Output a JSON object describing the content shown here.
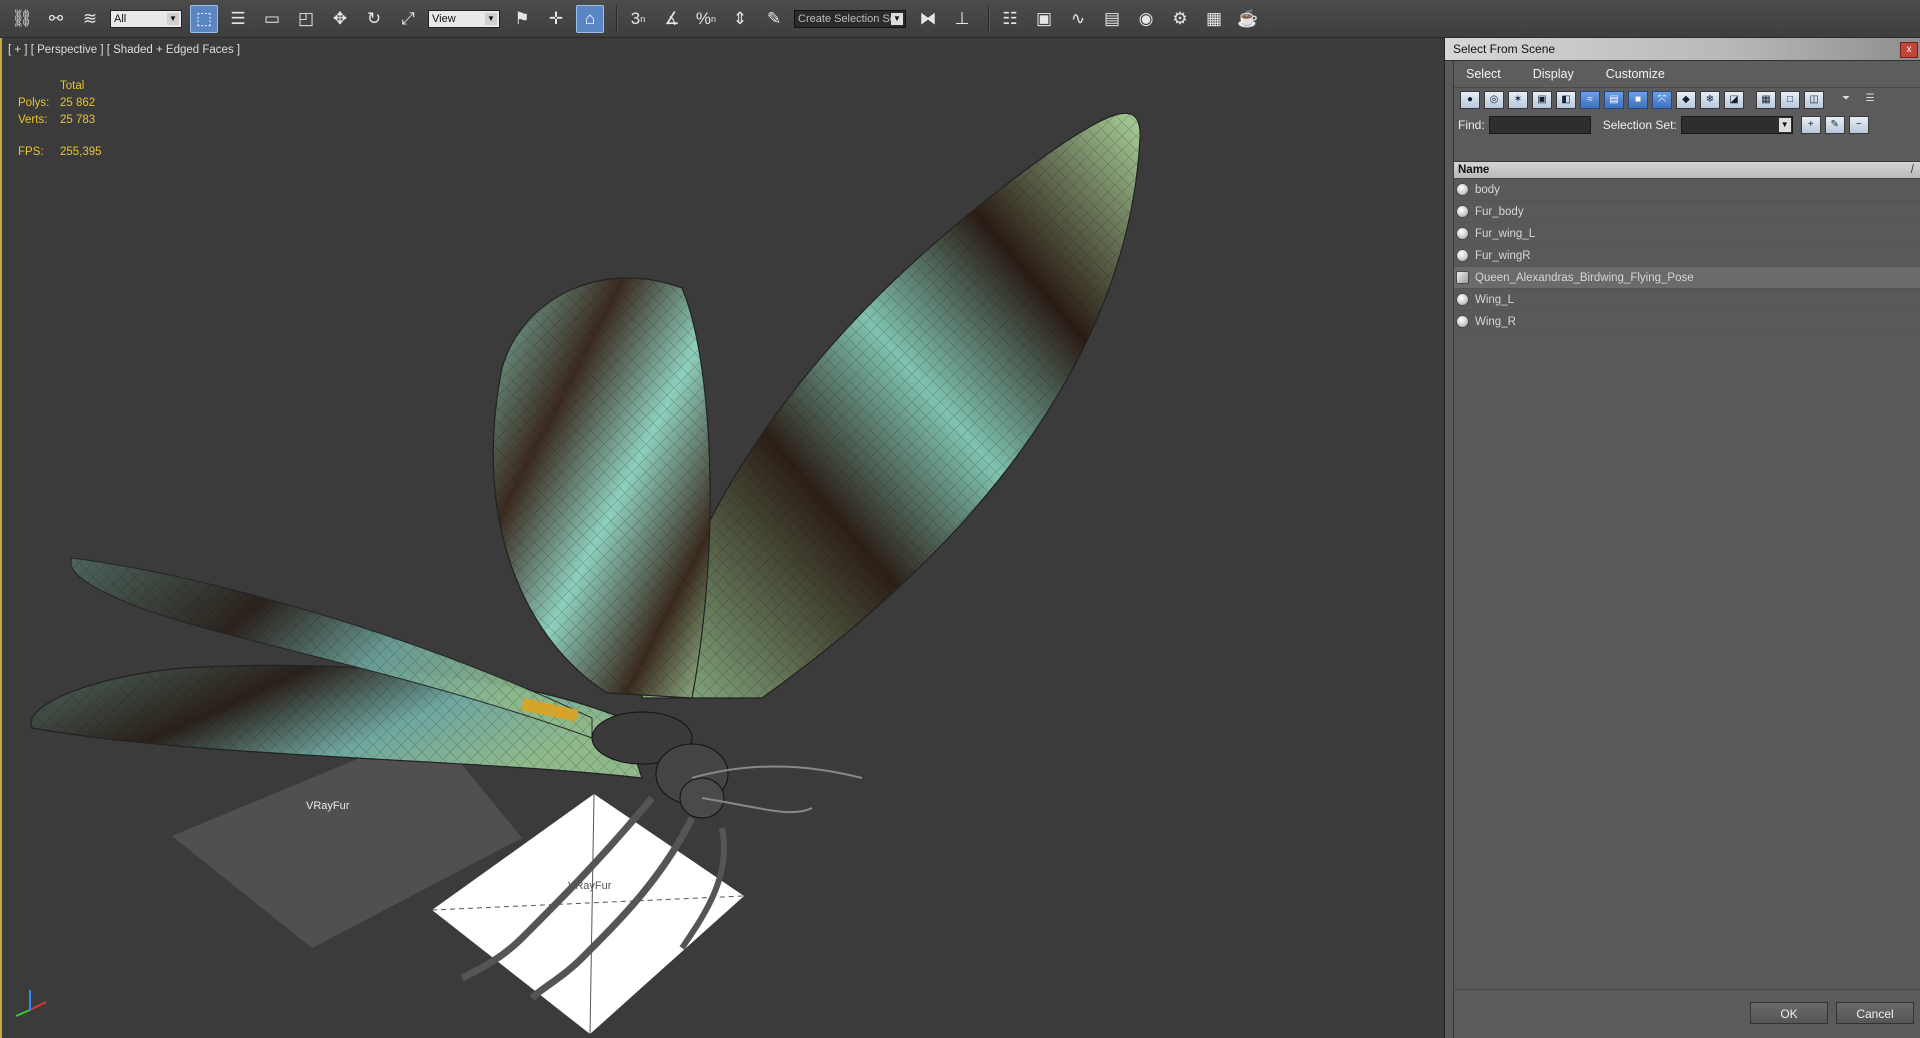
{
  "toolbar": {
    "selection_filter": "All",
    "reference_coord": "View",
    "named_selection_placeholder": "Create Selection Se",
    "snap_labels": [
      "3",
      "%"
    ],
    "icons": [
      "link-icon",
      "unlink-icon",
      "bind-spacewarp-icon",
      "select-object-icon",
      "select-by-name-icon",
      "rect-region-icon",
      "window-crossing-icon",
      "move-icon",
      "rotate-icon",
      "scale-icon",
      "pivot-icon",
      "select-manipulate-icon",
      "keyboard-shortcut-icon",
      "snaps-toggle-icon",
      "angle-snap-icon",
      "percent-snap-icon",
      "spinner-snap-icon",
      "edit-named-sel-icon",
      "mirror-icon",
      "align-icon",
      "layer-explorer-icon",
      "graphite-icon",
      "curve-editor-icon",
      "schematic-icon",
      "material-editor-icon",
      "render-setup-icon",
      "rendered-frame-icon",
      "render-icon"
    ]
  },
  "viewport": {
    "label": "[ + ] [ Perspective ] [ Shaded + Edged Faces ]",
    "stats": {
      "total_label": "Total",
      "polys_label": "Polys:",
      "polys_value": "25 862",
      "verts_label": "Verts:",
      "verts_value": "25 783",
      "fps_label": "FPS:",
      "fps_value": "255,395"
    },
    "fur_label_1": "VRayFur",
    "fur_label_2": "VRayFur"
  },
  "dialog": {
    "title": "Select From Scene",
    "close": "x",
    "menu": [
      "Select",
      "Display",
      "Customize"
    ],
    "find_label": "Find:",
    "find_value": "",
    "selection_set_label": "Selection Set:",
    "selection_set_value": "",
    "column_name": "Name",
    "sort_indicator": "/",
    "objects": [
      {
        "name": "body",
        "selected": false
      },
      {
        "name": "Fur_body",
        "selected": false
      },
      {
        "name": "Fur_wing_L",
        "selected": false
      },
      {
        "name": "Fur_wingR",
        "selected": false
      },
      {
        "name": "Queen_Alexandras_Birdwing_Flying_Pose",
        "selected": true
      },
      {
        "name": "Wing_L",
        "selected": false
      },
      {
        "name": "Wing_R",
        "selected": false
      }
    ],
    "ok": "OK",
    "cancel": "Cancel"
  }
}
